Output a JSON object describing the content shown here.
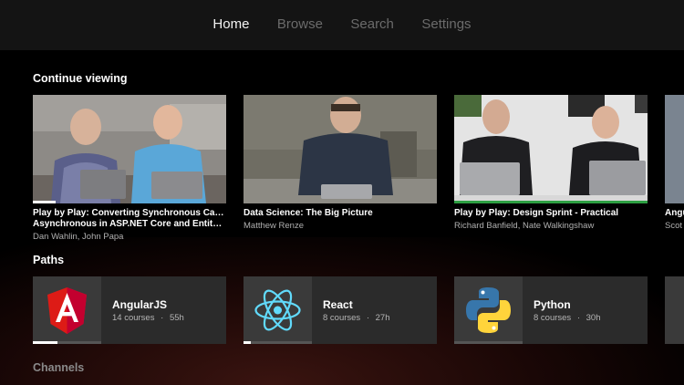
{
  "nav": {
    "items": [
      {
        "label": "Home",
        "active": true
      },
      {
        "label": "Browse",
        "active": false
      },
      {
        "label": "Search",
        "active": false
      },
      {
        "label": "Settings",
        "active": false
      }
    ]
  },
  "continue_viewing": {
    "title": "Continue viewing",
    "cards": [
      {
        "title_line1": "Play by Play: Converting Synchronous Calls to",
        "title_line2": "Asynchronous in ASP.NET Core and Entity F...",
        "authors": "Dan Wahlin, John Papa",
        "progress": 0.12
      },
      {
        "title_line1": "Data Science: The Big Picture",
        "title_line2": "",
        "authors": "Matthew Renze",
        "progress": 0.0
      },
      {
        "title_line1": "Play by Play: Design Sprint - Practical",
        "title_line2": "",
        "authors": "Richard Banfield, Nate Walkingshaw",
        "progress": 1.0
      },
      {
        "title_line1": "Angu",
        "title_line2": "",
        "authors": "Scot",
        "progress": 0.0
      }
    ]
  },
  "paths": {
    "title": "Paths",
    "items": [
      {
        "name": "AngularJS",
        "courses": "14 courses",
        "duration": "55h",
        "progress": 0.36
      },
      {
        "name": "React",
        "courses": "8 courses",
        "duration": "27h",
        "progress": 0.1
      },
      {
        "name": "Python",
        "courses": "8 courses",
        "duration": "30h",
        "progress": 0.0
      }
    ],
    "separator": "·"
  },
  "channels": {
    "title": "Channels"
  },
  "colors": {
    "progress_green": "#2ea043",
    "angular_red": "#dd1b16",
    "react_blue": "#61dafb",
    "python_blue": "#3776ab",
    "python_yellow": "#ffd43b"
  }
}
